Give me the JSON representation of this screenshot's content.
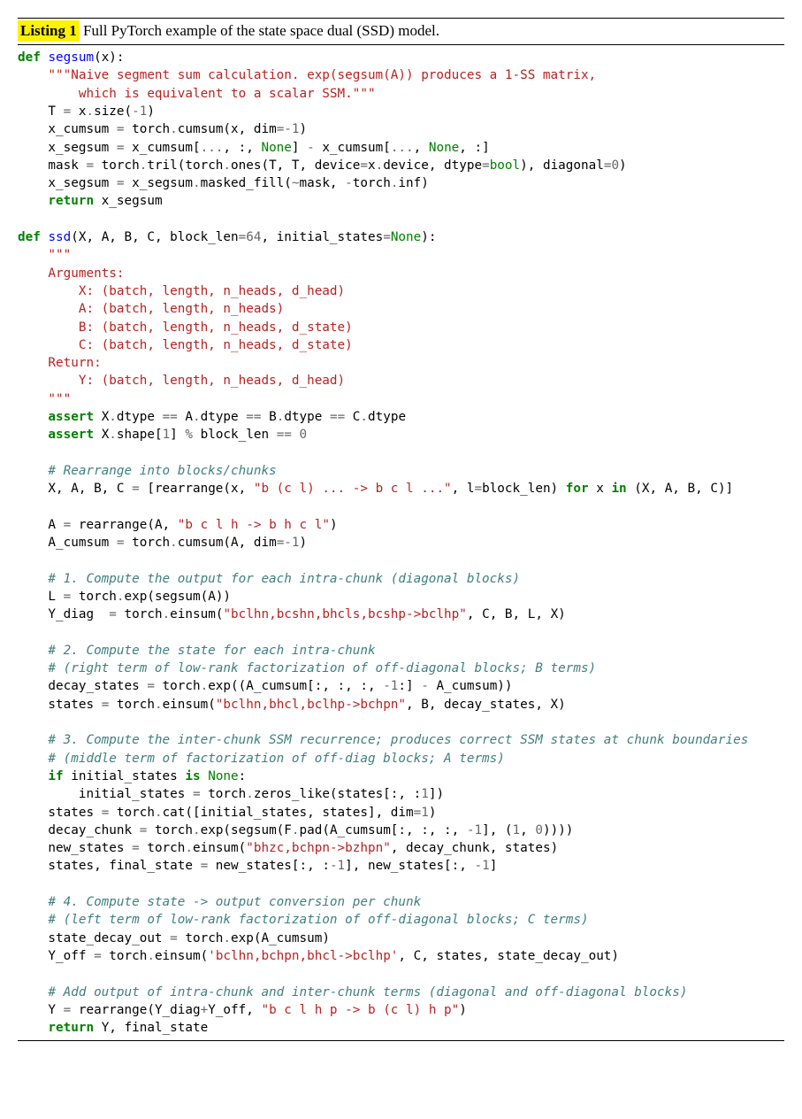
{
  "listing": {
    "label": "Listing 1",
    "caption": " Full PyTorch example of the state space dual (SSD) model."
  },
  "code": {
    "l01": {
      "kw": "def ",
      "fn": "segsum",
      "rest": "(x):"
    },
    "l02": "    \"\"\"Naive segment sum calculation. exp(segsum(A)) produces a 1-SS matrix,",
    "l03": "        which is equivalent to a scalar SSM.\"\"\"",
    "l04": {
      "pre": "    T ",
      "op1": "=",
      "mid": " x",
      "op2": ".",
      "rest": "size(",
      "num": "-1",
      "end": ")"
    },
    "l05": {
      "pre": "    x_cumsum ",
      "op1": "=",
      "mid": " torch",
      "op2": ".",
      "mid2": "cumsum(x, dim",
      "op3": "=-",
      "num": "1",
      "end": ")"
    },
    "l06": {
      "pre": "    x_segsum ",
      "op1": "=",
      "mid": " x_cumsum[",
      "op2": "...",
      "mid2": ", :, ",
      "nb": "None",
      "mid3": "] ",
      "op3": "-",
      "mid4": " x_cumsum[",
      "op4": "...",
      "mid5": ", ",
      "nb2": "None",
      "end": ", :]"
    },
    "l07": {
      "pre": "    mask ",
      "op1": "=",
      "mid": " torch",
      "op2": ".",
      "mid2": "tril(torch",
      "op3": ".",
      "mid3": "ones(T, T, device",
      "op4": "=",
      "mid4": "x",
      "op5": ".",
      "mid5": "device, dtype",
      "op6": "=",
      "nb": "bool",
      "mid6": "), diagonal",
      "op7": "=",
      "num": "0",
      "end": ")"
    },
    "l08": {
      "pre": "    x_segsum ",
      "op1": "=",
      "mid": " x_segsum",
      "op2": ".",
      "mid2": "masked_fill(",
      "op3": "~",
      "mid3": "mask, ",
      "op4": "-",
      "mid4": "torch",
      "op5": ".",
      "end": "inf)"
    },
    "l09": {
      "kw": "    return ",
      "rest": "x_segsum"
    },
    "l11": {
      "kw": "def ",
      "fn": "ssd",
      "mid": "(X, A, B, C, block_len",
      "op1": "=",
      "num": "64",
      "mid2": ", initial_states",
      "op2": "=",
      "nb": "None",
      "end": "):"
    },
    "l12": "    \"\"\"",
    "l13": "    Arguments:",
    "l14": "        X: (batch, length, n_heads, d_head)",
    "l15": "        A: (batch, length, n_heads)",
    "l16": "        B: (batch, length, n_heads, d_state)",
    "l17": "        C: (batch, length, n_heads, d_state)",
    "l18": "    Return:",
    "l19": "        Y: (batch, length, n_heads, d_head)",
    "l20": "    \"\"\"",
    "l21": {
      "kw": "    assert ",
      "mid": "X",
      "op1": ".",
      "mid2": "dtype ",
      "op2": "==",
      "mid3": " A",
      "op3": ".",
      "mid4": "dtype ",
      "op4": "==",
      "mid5": " B",
      "op5": ".",
      "mid6": "dtype ",
      "op6": "==",
      "mid7": " C",
      "op7": ".",
      "end": "dtype"
    },
    "l22": {
      "kw": "    assert ",
      "mid": "X",
      "op1": ".",
      "mid2": "shape[",
      "num": "1",
      "mid3": "] ",
      "op2": "%",
      "mid4": " block_len ",
      "op3": "==",
      "mid5": " ",
      "num2": "0"
    },
    "l24": "    # Rearrange into blocks/chunks",
    "l25": {
      "pre": "    X, A, B, C ",
      "op1": "=",
      "mid": " [rearrange(x, ",
      "str": "\"b (c l) ... -> b c l ...\"",
      "mid2": ", l",
      "op2": "=",
      "mid3": "block_len) ",
      "kw": "for ",
      "mid4": "x ",
      "kw2": "in ",
      "end": "(X, A, B, C)]"
    },
    "l27": {
      "pre": "    A ",
      "op1": "=",
      "mid": " rearrange(A, ",
      "str": "\"b c l h -> b h c l\"",
      "end": ")"
    },
    "l28": {
      "pre": "    A_cumsum ",
      "op1": "=",
      "mid": " torch",
      "op2": ".",
      "mid2": "cumsum(A, dim",
      "op3": "=-",
      "num": "1",
      "end": ")"
    },
    "l30": "    # 1. Compute the output for each intra-chunk (diagonal blocks)",
    "l31": {
      "pre": "    L ",
      "op1": "=",
      "mid": " torch",
      "op2": ".",
      "end": "exp(segsum(A))"
    },
    "l32": {
      "pre": "    Y_diag  ",
      "op1": "=",
      "mid": " torch",
      "op2": ".",
      "mid2": "einsum(",
      "str": "\"bclhn,bcshn,bhcls,bcshp->bclhp\"",
      "end": ", C, B, L, X)"
    },
    "l34": "    # 2. Compute the state for each intra-chunk",
    "l35": "    # (right term of low-rank factorization of off-diagonal blocks; B terms)",
    "l36": {
      "pre": "    decay_states ",
      "op1": "=",
      "mid": " torch",
      "op2": ".",
      "mid2": "exp((A_cumsum[:, :, :, ",
      "op3": "-",
      "num": "1",
      "mid3": ":] ",
      "op4": "-",
      "end": " A_cumsum))"
    },
    "l37": {
      "pre": "    states ",
      "op1": "=",
      "mid": " torch",
      "op2": ".",
      "mid2": "einsum(",
      "str": "\"bclhn,bhcl,bclhp->bchpn\"",
      "end": ", B, decay_states, X)"
    },
    "l39": "    # 3. Compute the inter-chunk SSM recurrence; produces correct SSM states at chunk boundaries",
    "l40": "    # (middle term of factorization of off-diag blocks; A terms)",
    "l41": {
      "kw": "    if ",
      "mid": "initial_states ",
      "kw2": "is ",
      "nb": "None",
      "end": ":"
    },
    "l42": {
      "pre": "        initial_states ",
      "op1": "=",
      "mid": " torch",
      "op2": ".",
      "mid2": "zeros_like(states[:, :",
      "num": "1",
      "end": "])"
    },
    "l43": {
      "pre": "    states ",
      "op1": "=",
      "mid": " torch",
      "op2": ".",
      "mid2": "cat([initial_states, states], dim",
      "op3": "=",
      "num": "1",
      "end": ")"
    },
    "l44": {
      "pre": "    decay_chunk ",
      "op1": "=",
      "mid": " torch",
      "op2": ".",
      "mid2": "exp(segsum(F",
      "op3": ".",
      "mid3": "pad(A_cumsum[:, :, :, ",
      "op4": "-",
      "num": "1",
      "mid4": "], (",
      "num2": "1",
      "mid5": ", ",
      "num3": "0",
      "end": "))))"
    },
    "l45": {
      "pre": "    new_states ",
      "op1": "=",
      "mid": " torch",
      "op2": ".",
      "mid2": "einsum(",
      "str": "\"bhzc,bchpn->bzhpn\"",
      "end": ", decay_chunk, states)"
    },
    "l46": {
      "pre": "    states, final_state ",
      "op1": "=",
      "mid": " new_states[:, :",
      "op2": "-",
      "num": "1",
      "mid2": "], new_states[:, ",
      "op3": "-",
      "num2": "1",
      "end": "]"
    },
    "l48": "    # 4. Compute state -> output conversion per chunk",
    "l49": "    # (left term of low-rank factorization of off-diagonal blocks; C terms)",
    "l50": {
      "pre": "    state_decay_out ",
      "op1": "=",
      "mid": " torch",
      "op2": ".",
      "end": "exp(A_cumsum)"
    },
    "l51": {
      "pre": "    Y_off ",
      "op1": "=",
      "mid": " torch",
      "op2": ".",
      "mid2": "einsum(",
      "str": "'bclhn,bchpn,bhcl->bclhp'",
      "end": ", C, states, state_decay_out)"
    },
    "l53": "    # Add output of intra-chunk and inter-chunk terms (diagonal and off-diagonal blocks)",
    "l54": {
      "pre": "    Y ",
      "op1": "=",
      "mid": " rearrange(Y_diag",
      "op2": "+",
      "mid2": "Y_off, ",
      "str": "\"b c l h p -> b (c l) h p\"",
      "end": ")"
    },
    "l55": {
      "kw": "    return ",
      "rest": "Y, final_state"
    }
  }
}
